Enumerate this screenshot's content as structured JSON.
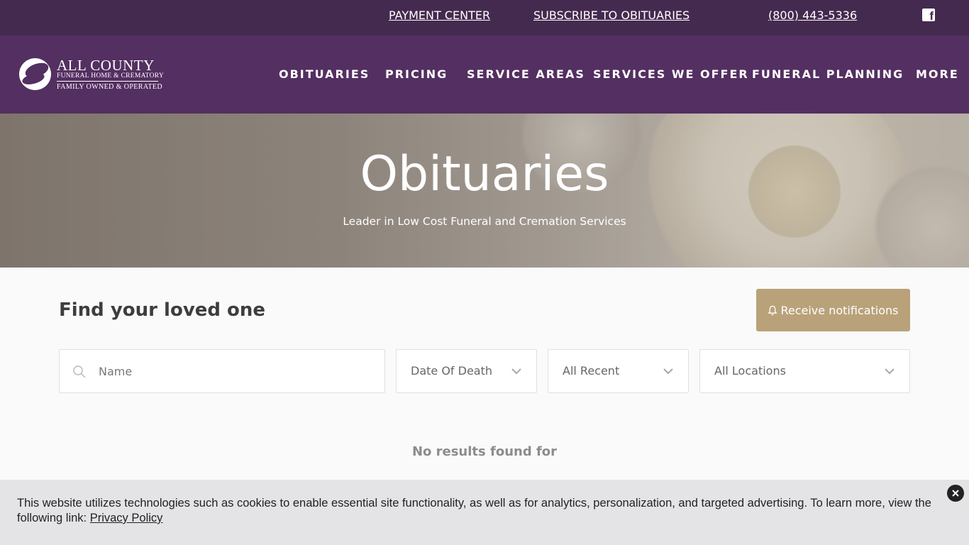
{
  "topbar": {
    "payment_center": "PAYMENT CENTER",
    "subscribe": "SUBSCRIBE TO OBITUARIES",
    "phone": "(800) 443-5336",
    "facebook_icon": "facebook-icon"
  },
  "logo": {
    "name": "ALL COUNTY",
    "sub": "FUNERAL HOME & CREMATORY",
    "tagline": "FAMILY OWNED & OPERATED"
  },
  "nav": {
    "items": [
      "OBITUARIES",
      "PRICING",
      "SERVICE AREAS",
      "SERVICES WE OFFER",
      "FUNERAL PLANNING",
      "MORE"
    ]
  },
  "hero": {
    "title": "Obituaries",
    "subtitle": "Leader in Low Cost Funeral and Cremation Services"
  },
  "search": {
    "heading": "Find your loved one",
    "notify_label": "Receive notifications",
    "name_placeholder": "Name",
    "date_filter": "Date Of Death",
    "recent_filter": "All Recent",
    "location_filter": "All Locations"
  },
  "results": {
    "empty_text": "No results found for"
  },
  "cookie": {
    "text": "This website utilizes technologies such as cookies to enable essential site functionality, as well as for analytics, personalization, and targeted advertising. To learn more, view the following link: ",
    "link_label": "Privacy Policy"
  },
  "colors": {
    "topbar": "#442a4f",
    "nav": "#542f61",
    "accent_button": "#b9a27a"
  }
}
